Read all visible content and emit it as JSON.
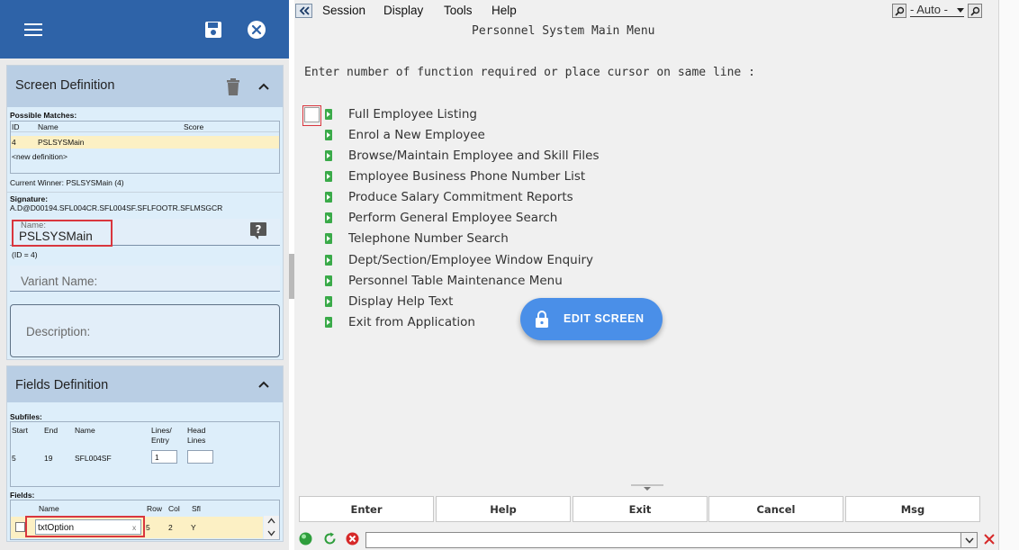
{
  "left_panel": {
    "screen_definition": {
      "title": "Screen Definition",
      "possible_matches_label": "Possible Matches:",
      "columns": [
        "ID",
        "Name",
        "Score"
      ],
      "rows": [
        {
          "id": "4",
          "name": "PSLSYSMain",
          "score": ""
        }
      ],
      "new_definition": "<new definition>",
      "current_winner": "Current Winner: PSLSYSMain (4)",
      "signature_label": "Signature:",
      "signature_value": "A.D@D00194.SFL004CR.SFL004SF.SFLFOOTR.SFLMSGCR",
      "name_label": "Name:",
      "name_value": "PSLSYSMain",
      "id_note": "(ID = 4)",
      "variant_label": "Variant Name:",
      "description_label": "Description:"
    },
    "fields_definition": {
      "title": "Fields Definition",
      "subfiles_label": "Subfiles:",
      "subfile_columns": [
        "Start",
        "End",
        "Name",
        "Lines/\nEntry",
        "Head\nLines"
      ],
      "subfile_col_start": "Start",
      "subfile_col_end": "End",
      "subfile_col_name": "Name",
      "subfile_col_lines1": "Lines/",
      "subfile_col_lines2": "Entry",
      "subfile_col_head1": "Head",
      "subfile_col_head2": "Lines",
      "subfile_row": {
        "start": "5",
        "end": "19",
        "name": "SFL004SF",
        "lines": "1",
        "head": ""
      },
      "fields_label": "Fields:",
      "fields_col_name": "Name",
      "fields_col_row": "Row",
      "fields_col_col": "Col",
      "fields_col_sfl": "Sfl",
      "field_row": {
        "name": "txtOption",
        "row": "5",
        "col": "2",
        "sfl": "Y"
      },
      "clear_glyph": "x"
    }
  },
  "main": {
    "menu": [
      "Session",
      "Display",
      "Tools",
      "Help"
    ],
    "zoom_value": "- Auto -",
    "screen_title": "Personnel System Main Menu",
    "prompt": "Enter number of function required or place cursor on same line :",
    "menu_options": [
      "Full Employee Listing",
      "Enrol a New Employee",
      "Browse/Maintain Employee and Skill Files",
      "Employee Business Phone Number List",
      "Produce Salary Commitment Reports",
      "Perform General Employee Search",
      "Telephone Number Search",
      "Dept/Section/Employee Window Enquiry",
      "Personnel Table Maintenance Menu",
      "Display Help Text",
      "Exit from Application"
    ],
    "edit_screen_label": "EDIT SCREEN",
    "function_keys": [
      "Enter",
      "Help",
      "Exit",
      "Cancel",
      "Msg"
    ]
  },
  "colors": {
    "top_bar": "#2e63a8",
    "card_header": "#b9cee4",
    "card_body": "#ddeefa",
    "highlight_row": "#fcf0c4",
    "accent_red": "#d9363e",
    "edit_button": "#4a8fe8",
    "menu_arrow": "#3aaa49"
  }
}
